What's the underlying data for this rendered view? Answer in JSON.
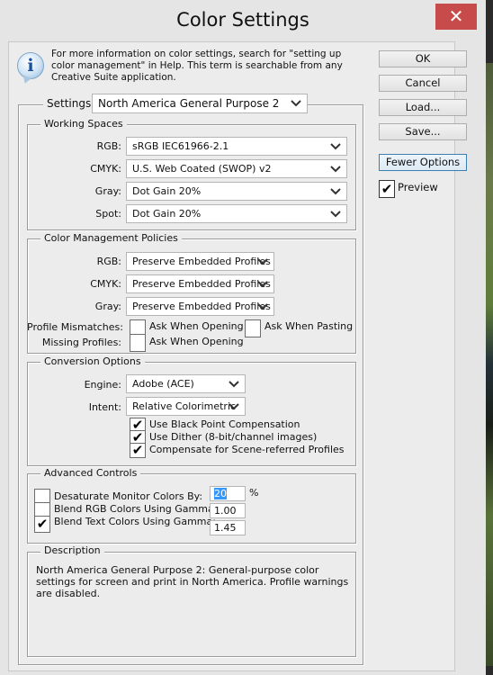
{
  "window": {
    "title": "Color Settings",
    "close_label": "✕"
  },
  "info": {
    "icon": "info-icon",
    "glyph": "i",
    "text": "For more information on color settings, search for \"setting up color management\" in Help. This term is searchable from any Creative Suite application."
  },
  "buttons": {
    "ok": "OK",
    "cancel": "Cancel",
    "load": "Load...",
    "save": "Save...",
    "fewer_options": "Fewer Options"
  },
  "preview": {
    "label": "Preview",
    "checked": true,
    "check_glyph": "✔"
  },
  "settings": {
    "label": "Settings:",
    "value": "North America General Purpose 2"
  },
  "working_spaces": {
    "title": "Working Spaces",
    "rows": [
      {
        "label": "RGB:",
        "value": "sRGB IEC61966-2.1"
      },
      {
        "label": "CMYK:",
        "value": "U.S. Web Coated (SWOP) v2"
      },
      {
        "label": "Gray:",
        "value": "Dot Gain 20%"
      },
      {
        "label": "Spot:",
        "value": "Dot Gain 20%"
      }
    ]
  },
  "policies": {
    "title": "Color Management Policies",
    "rows": [
      {
        "label": "RGB:",
        "value": "Preserve Embedded Profiles"
      },
      {
        "label": "CMYK:",
        "value": "Preserve Embedded Profiles"
      },
      {
        "label": "Gray:",
        "value": "Preserve Embedded Profiles"
      }
    ],
    "profile_mismatches_label": "Profile Mismatches:",
    "mismatch_open_label": "Ask When Opening",
    "mismatch_open_checked": false,
    "mismatch_paste_label": "Ask When Pasting",
    "mismatch_paste_checked": false,
    "missing_profiles_label": "Missing Profiles:",
    "missing_open_label": "Ask When Opening",
    "missing_open_checked": false
  },
  "conversion": {
    "title": "Conversion Options",
    "engine_label": "Engine:",
    "engine_value": "Adobe (ACE)",
    "intent_label": "Intent:",
    "intent_value": "Relative Colorimetric",
    "checks": [
      {
        "label": "Use Black Point Compensation",
        "checked": true
      },
      {
        "label": "Use Dither (8-bit/channel images)",
        "checked": true
      },
      {
        "label": "Compensate for Scene-referred Profiles",
        "checked": true
      }
    ]
  },
  "advanced": {
    "title": "Advanced Controls",
    "rows": [
      {
        "label": "Desaturate Monitor Colors By:",
        "checked": false,
        "value": "20",
        "unit": "%"
      },
      {
        "label": "Blend RGB Colors Using Gamma:",
        "checked": false,
        "value": "1.00"
      },
      {
        "label": "Blend Text Colors Using Gamma:",
        "checked": true,
        "value": "1.45"
      }
    ]
  },
  "description": {
    "title": "Description",
    "text": "North America General Purpose 2:  General-purpose color settings for screen and print in North America. Profile warnings are disabled."
  },
  "colors": {
    "close_red": "#c74b4b",
    "dialog_bg": "#ececec",
    "focus_blue": "#3c7fb1",
    "selection_blue": "#3399ff"
  }
}
